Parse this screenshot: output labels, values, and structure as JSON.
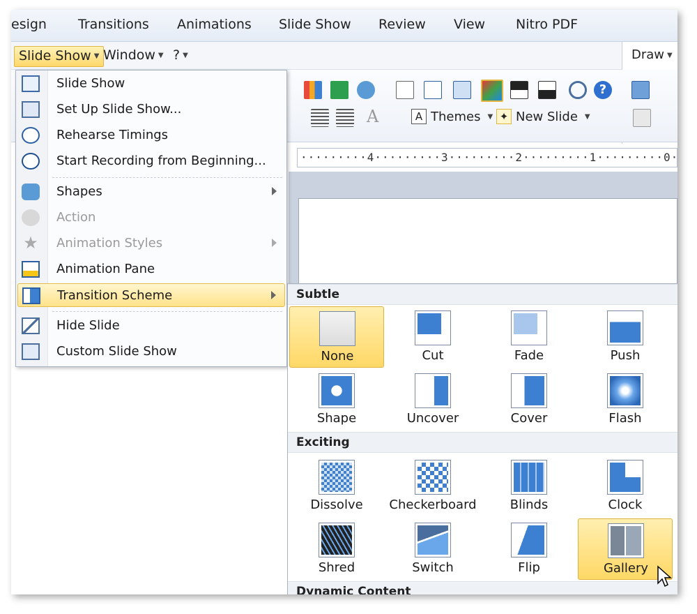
{
  "ribbon_tabs": [
    "esign",
    "Transitions",
    "Animations",
    "Slide Show",
    "Review",
    "View",
    "Nitro PDF"
  ],
  "menubar": {
    "items": [
      {
        "label": "Slide Show",
        "active": true
      },
      {
        "label": "Window",
        "active": false
      },
      {
        "label": "?",
        "active": false
      }
    ],
    "draw_label": "Draw"
  },
  "ribbon": {
    "themes_label": "Themes",
    "new_slide_label": "New Slide"
  },
  "ruler_text": "·········4·········3·········2·········1·········0·",
  "dropdown": {
    "items": [
      {
        "label": "Slide Show",
        "icon": "slide-show-icon",
        "disabled": false,
        "submenu": false
      },
      {
        "label": "Set Up Slide Show...",
        "icon": "setup-show-icon",
        "disabled": false,
        "submenu": false
      },
      {
        "label": "Rehearse Timings",
        "icon": "rehearse-timings-icon",
        "disabled": false,
        "submenu": false
      },
      {
        "label": "Start Recording from Beginning...",
        "icon": "record-icon",
        "disabled": false,
        "submenu": false
      },
      {
        "label": "Shapes",
        "icon": "shapes-icon",
        "disabled": false,
        "submenu": true
      },
      {
        "label": "Action",
        "icon": "action-icon",
        "disabled": true,
        "submenu": false
      },
      {
        "label": "Animation Styles",
        "icon": "star-icon",
        "disabled": true,
        "submenu": true
      },
      {
        "label": "Animation Pane",
        "icon": "animation-pane-icon",
        "disabled": false,
        "submenu": false
      },
      {
        "label": "Transition Scheme",
        "icon": "transition-icon",
        "disabled": false,
        "submenu": true,
        "highlighted": true
      },
      {
        "label": "Hide Slide",
        "icon": "hide-slide-icon",
        "disabled": false,
        "submenu": false
      },
      {
        "label": "Custom Slide Show",
        "icon": "custom-show-icon",
        "disabled": false,
        "submenu": false
      }
    ]
  },
  "gallery": {
    "sections": [
      {
        "title": "Subtle",
        "items": [
          "None",
          "Cut",
          "Fade",
          "Push",
          "Shape",
          "Uncover",
          "Cover",
          "Flash"
        ]
      },
      {
        "title": "Exciting",
        "items": [
          "Dissolve",
          "Checkerboard",
          "Blinds",
          "Clock",
          "Shred",
          "Switch",
          "Flip",
          "Gallery"
        ]
      },
      {
        "title": "Dynamic Content",
        "items": []
      }
    ],
    "selected": [
      "None",
      "Gallery"
    ]
  },
  "colors": {
    "highlight": "#ffd866",
    "thumb_blue": "#3d7fd1"
  }
}
